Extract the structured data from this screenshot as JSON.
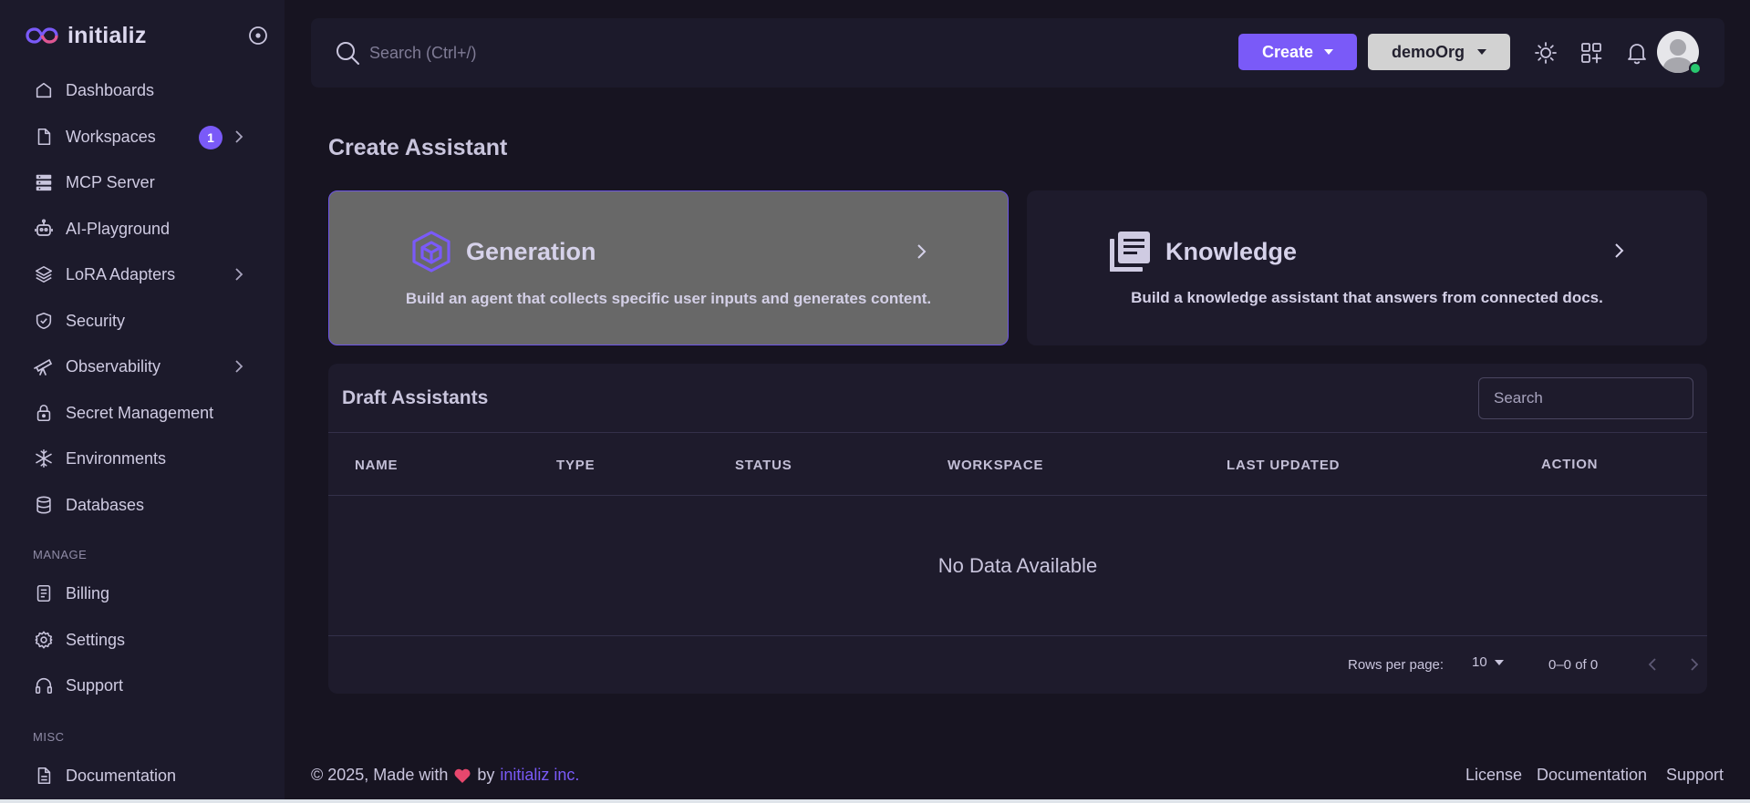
{
  "brand": {
    "name": "initializ",
    "logo_icon": "infinity-logo-icon",
    "accent": "#7a5af8"
  },
  "sidebar": {
    "items": [
      {
        "label": "Dashboards",
        "icon": "home-icon"
      },
      {
        "label": "Workspaces",
        "icon": "file-icon",
        "badge": "1",
        "has_chevron": true
      },
      {
        "label": "MCP Server",
        "icon": "server-icon"
      },
      {
        "label": "AI-Playground",
        "icon": "robot-icon"
      },
      {
        "label": "LoRA Adapters",
        "icon": "layers-icon",
        "has_chevron": true
      },
      {
        "label": "Security",
        "icon": "shield-check-icon"
      },
      {
        "label": "Observability",
        "icon": "telescope-icon",
        "has_chevron": true
      },
      {
        "label": "Secret Management",
        "icon": "lock-icon"
      },
      {
        "label": "Environments",
        "icon": "snowflake-icon"
      },
      {
        "label": "Databases",
        "icon": "database-icon"
      }
    ],
    "manage_section": "MANAGE",
    "manage_items": [
      {
        "label": "Billing",
        "icon": "receipt-icon"
      },
      {
        "label": "Settings",
        "icon": "gear-icon"
      },
      {
        "label": "Support",
        "icon": "headphones-icon"
      }
    ],
    "misc_section": "MISC",
    "misc_items": [
      {
        "label": "Documentation",
        "icon": "document-icon"
      }
    ]
  },
  "header": {
    "search_placeholder": "Search (Ctrl+/)",
    "create_label": "Create",
    "org_label": "demoOrg"
  },
  "main": {
    "title": "Create Assistant",
    "cards": [
      {
        "title": "Generation",
        "description": "Build an agent that collects specific user inputs and generates content.",
        "icon": "cube-icon"
      },
      {
        "title": "Knowledge",
        "description": "Build a knowledge assistant that answers from connected docs.",
        "icon": "library-icon"
      }
    ],
    "drafts": {
      "title": "Draft Assistants",
      "search_placeholder": "Search",
      "columns": [
        "NAME",
        "TYPE",
        "STATUS",
        "WORKSPACE",
        "LAST UPDATED",
        "ACTION"
      ],
      "rows": [],
      "empty_text": "No Data Available",
      "rows_per_page_label": "Rows per page:",
      "rows_per_page": "10",
      "range": "0–0 of 0"
    }
  },
  "footer": {
    "copyright": "© 2025, Made with",
    "by": "by",
    "company": "initializ inc.",
    "links": [
      "License",
      "Documentation",
      "Support"
    ]
  }
}
